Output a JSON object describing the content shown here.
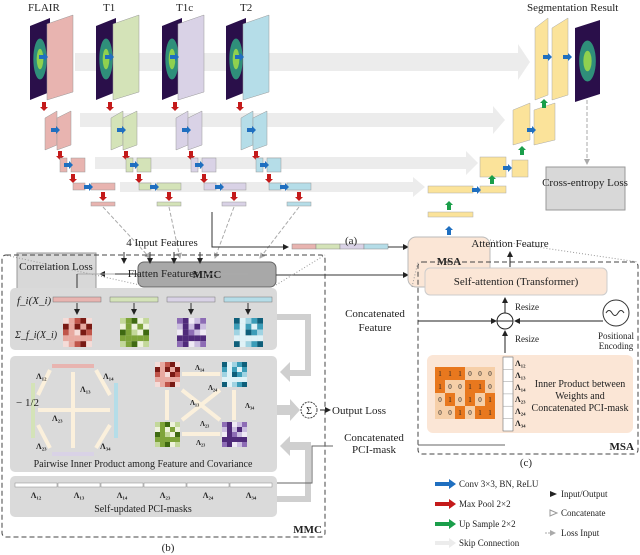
{
  "colors": {
    "flair": "#e8b4b0",
    "t1": "#d4e3b8",
    "t1c": "#d9d2e6",
    "t2": "#b5dde8",
    "decoder": "#fbe39a",
    "conv": "#1f6fc0",
    "pool": "#c41a1a",
    "up": "#1a9e4a",
    "skip": "#ececec",
    "panel": "#dadada",
    "msa_fill": "#fbe6d6",
    "orange": "#e8781e",
    "box_gray": "#a8a8a8",
    "loss_gray": "#d8d8d8"
  },
  "encoder": {
    "modalities": [
      "FLAIR",
      "T1",
      "T1c",
      "T2"
    ],
    "output_label": "Segmentation Result"
  },
  "boxes": {
    "cross_entropy": "Cross-entropy Loss",
    "correlation": "Correlation Loss",
    "mmc": "MMC",
    "msa": "MSA"
  },
  "captions": {
    "a": "(a)",
    "b": "(b)",
    "c": "(c)"
  },
  "mmc_panel": {
    "input_label": "4 Input Features",
    "flatten_label": "Flatten  Features",
    "feature_row_label": "f_i(X_i)",
    "cov_row_label": "Σ_f_i(X_i)",
    "pair_labels": [
      "Λ₁₂",
      "Λ₁₃",
      "Λ₁₄",
      "Λ₂₃",
      "Λ₂₄",
      "Λ₃₄"
    ],
    "half_label": "− 1/2",
    "pairwise_caption": "Pairwise Inner Product among Feature and Covariance",
    "mask_caption": "Self-updated PCI-masks",
    "sum_symbol": "Σ",
    "output_loss": "Output Loss",
    "concat_mask": [
      "Concatenated",
      "PCI-mask"
    ],
    "title": "MMC"
  },
  "msa_panel": {
    "attention_feature": "Attention Feature",
    "self_attention": "Self-attention (Transformer)",
    "resize": "Resize",
    "concat_feature": [
      "Concatenated",
      "Feature"
    ],
    "positional_encoding": [
      "Positional",
      "Encoding"
    ],
    "matrix": [
      [
        1,
        1,
        1,
        0,
        0,
        0
      ],
      [
        1,
        0,
        0,
        1,
        1,
        0
      ],
      [
        0,
        1,
        0,
        1,
        0,
        1
      ],
      [
        0,
        0,
        1,
        0,
        1,
        1
      ]
    ],
    "mask_labels": [
      "Λ₁₂",
      "Λ₁₃",
      "Λ₁₄",
      "Λ₂₃",
      "Λ₂₄",
      "Λ₃₄"
    ],
    "inner_product": [
      "Inner Product between",
      "Weights and",
      "Concatenated PCI-mask"
    ],
    "title": "MSA"
  },
  "legend": {
    "conv": "Conv 3×3, BN, ReLU",
    "pool": "Max Pool 2×2",
    "up": "Up Sample 2×2",
    "skip": "Skip Connection",
    "io": "Input/Output",
    "concat": "Concatenate",
    "loss": "Loss Input"
  }
}
